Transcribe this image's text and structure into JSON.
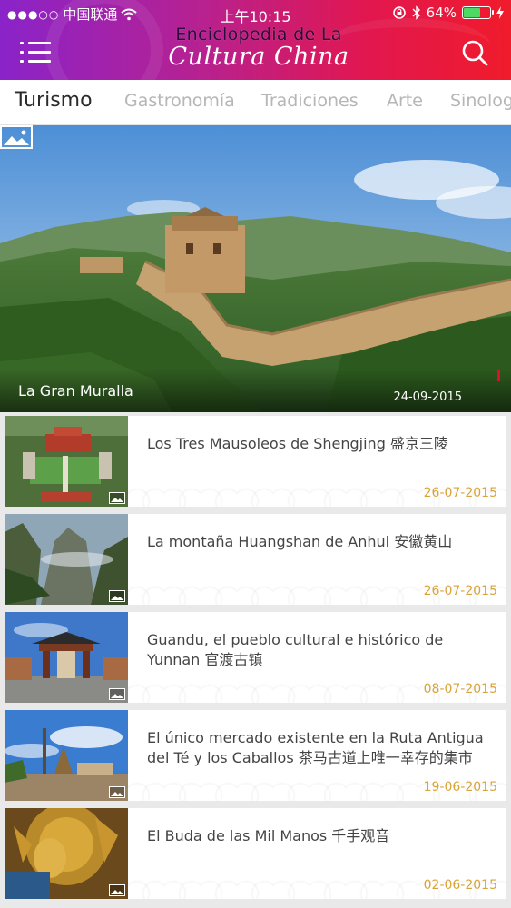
{
  "status_bar": {
    "carrier": "中国联通",
    "time": "上午10:15",
    "battery": "64%",
    "battery_level": 0.64
  },
  "header": {
    "brand_top": "Enciclopedia de La",
    "brand_bottom": "Cultura China",
    "menu_icon": "menu-icon",
    "search_icon": "search-icon",
    "colors": {
      "gradient_start": "#8a23c9",
      "gradient_end": "#f01b2b"
    }
  },
  "tabs": [
    {
      "label": "Turismo",
      "active": true
    },
    {
      "label": "Gastronomía",
      "active": false
    },
    {
      "label": "Tradiciones",
      "active": false
    },
    {
      "label": "Arte",
      "active": false
    },
    {
      "label": "Sinología",
      "active": false
    }
  ],
  "featured": {
    "title": "La Gran Muralla",
    "date": "24-09-2015",
    "icon": "gallery-icon"
  },
  "articles": [
    {
      "title": "Los Tres Mausoleos de Shengjing 盛京三陵",
      "date": "26-07-2015"
    },
    {
      "title": "La montaña Huangshan de Anhui 安徽黄山",
      "date": "26-07-2015"
    },
    {
      "title": "Guandu, el pueblo cultural e histórico de Yunnan 官渡古镇",
      "date": "08-07-2015"
    },
    {
      "title": "El único mercado existente en la Ruta Antigua del Té y los Caballos 茶马古道上唯一幸存的集市",
      "date": "19-06-2015"
    },
    {
      "title": "El Buda de las Mil Manos 千手观音",
      "date": "02-06-2015"
    }
  ],
  "accent_date_color": "#d9a338"
}
